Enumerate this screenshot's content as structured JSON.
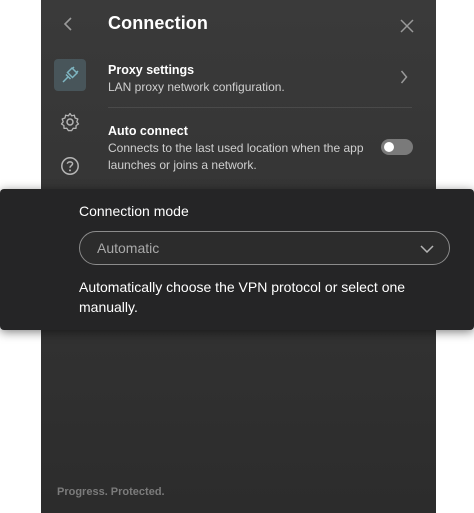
{
  "header": {
    "title": "Connection"
  },
  "settings": {
    "proxy": {
      "title": "Proxy settings",
      "description": "LAN proxy network configuration."
    },
    "auto_connect": {
      "title": "Auto connect",
      "description": "Connects to the last used location when the app launches or joins a network.",
      "enabled": false
    }
  },
  "connection_mode": {
    "label": "Connection mode",
    "selected": "Automatic",
    "description": "Automatically choose the VPN protocol or select one manually."
  },
  "footer": {
    "tagline": "Progress. Protected."
  },
  "icons": {
    "back": "chevron-left-icon",
    "close": "close-icon",
    "nav_connection": "plug-icon",
    "nav_settings": "gear-icon",
    "nav_help": "help-icon"
  },
  "colors": {
    "panel_background": "#353535",
    "popup_background": "#252526",
    "active_nav": "#48555a",
    "accent_icon": "#7fb6c2"
  }
}
